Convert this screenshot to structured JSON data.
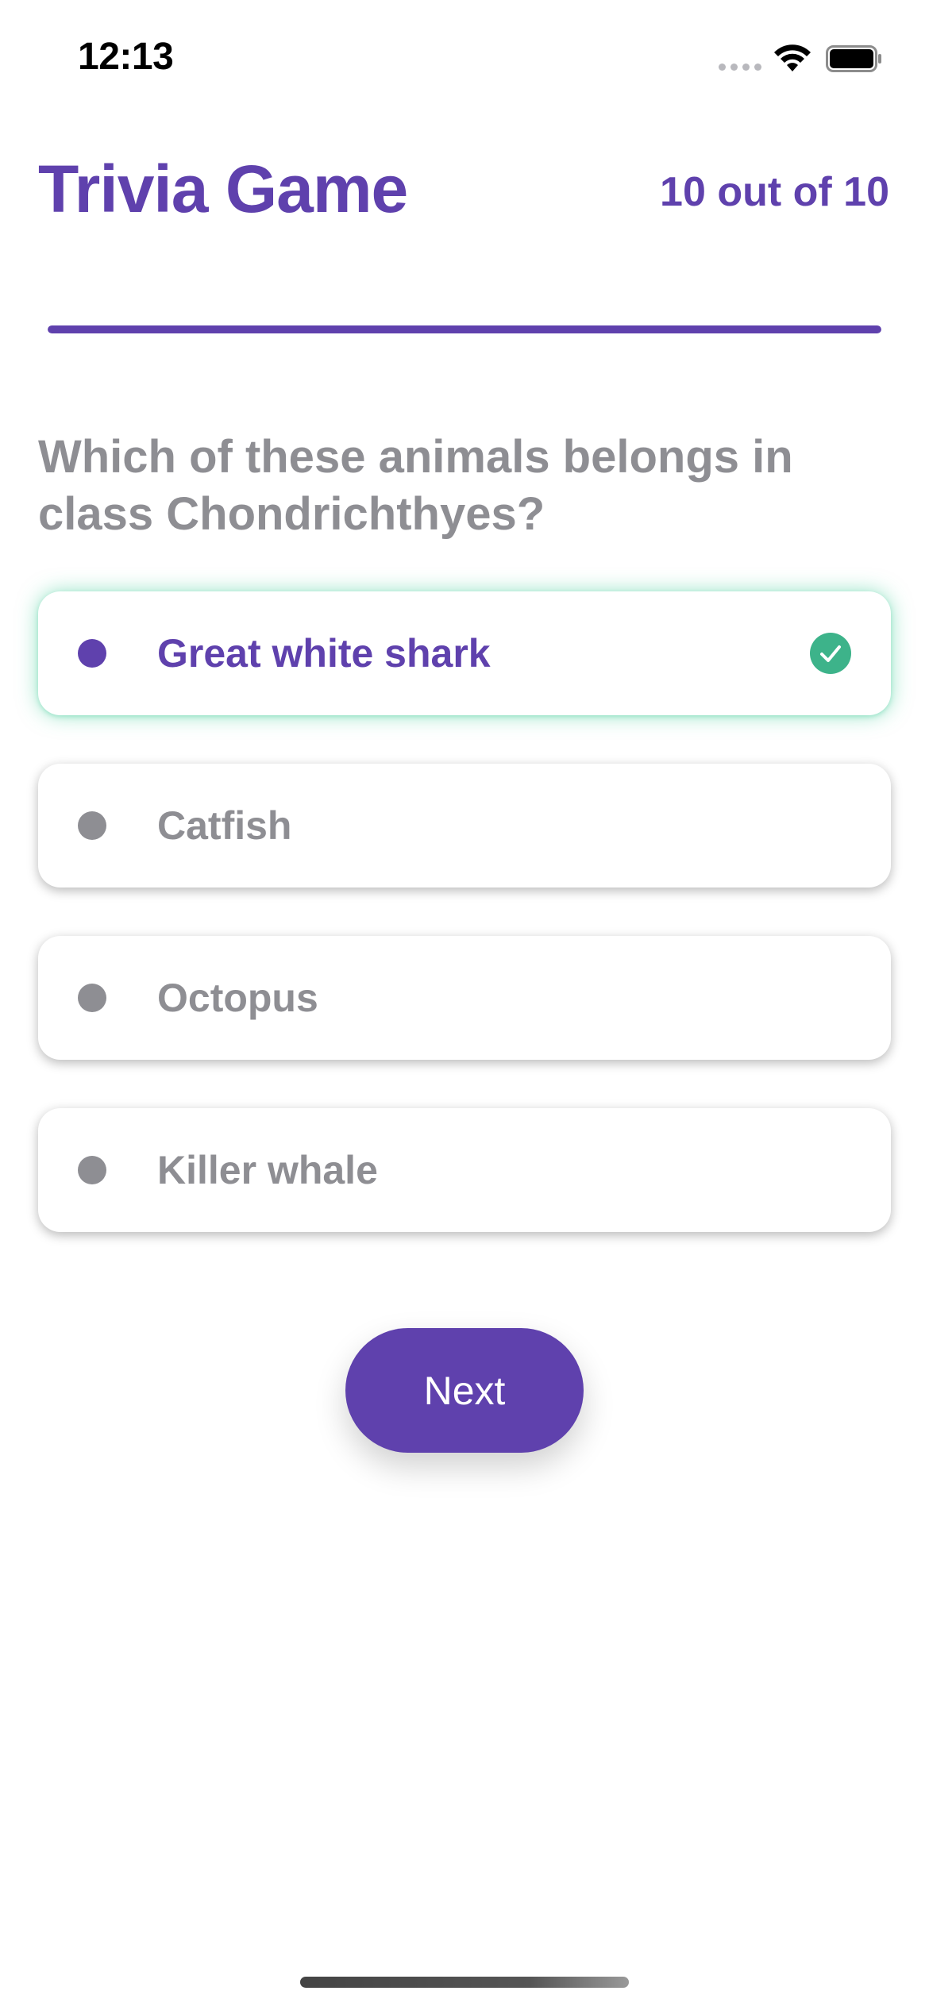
{
  "status_bar": {
    "time": "12:13"
  },
  "header": {
    "title": "Trivia Game",
    "counter": "10 out of 10"
  },
  "progress": {
    "fraction": 1.0
  },
  "question": {
    "text": "Which of these animals belongs in class Chondrichthyes?"
  },
  "answers": [
    {
      "label": "Great white shark",
      "state": "correct"
    },
    {
      "label": "Catfish",
      "state": "unselected"
    },
    {
      "label": "Octopus",
      "state": "unselected"
    },
    {
      "label": "Killer whale",
      "state": "unselected"
    }
  ],
  "actions": {
    "next_label": "Next"
  },
  "colors": {
    "accent": "#5f41ad",
    "correct": "#3db38a",
    "muted": "#8e8e93"
  }
}
